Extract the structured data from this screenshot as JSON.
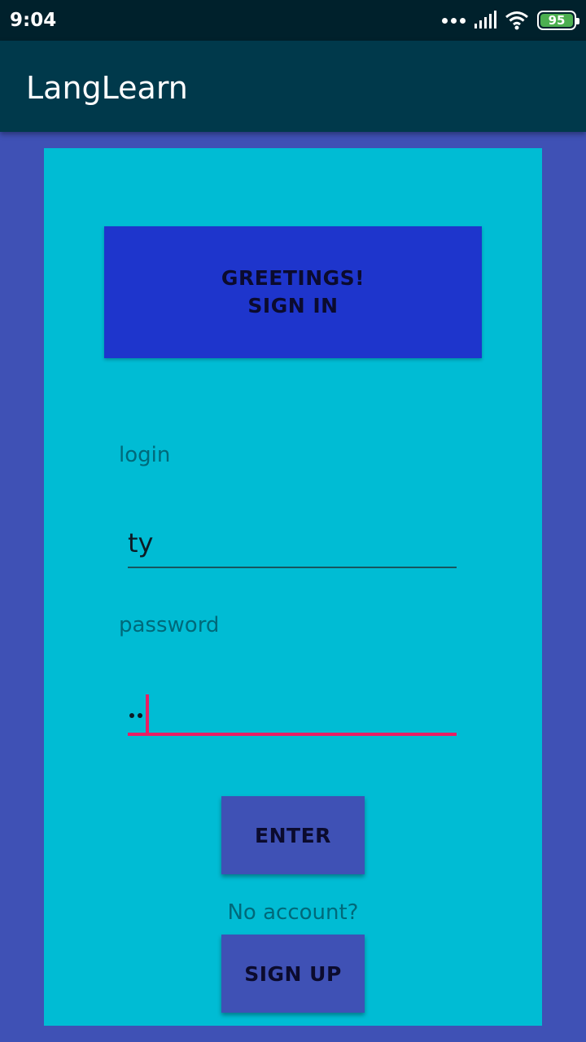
{
  "status_bar": {
    "time": "9:04",
    "battery_level": "95",
    "icons": [
      "more-dots-icon",
      "signal-icon",
      "wifi-icon",
      "battery-icon"
    ]
  },
  "app_bar": {
    "title": "LangLearn"
  },
  "form": {
    "greeting_line1": "GREETINGS!",
    "greeting_line2": "SIGN IN",
    "login_label": "login",
    "login_value": "ty",
    "password_label": "password",
    "password_masked_length": 2,
    "enter_label": "ENTER",
    "no_account_text": "No account?",
    "signup_label": "SIGN UP"
  },
  "colors": {
    "background": "#3f51b5",
    "status_bar": "#00212c",
    "app_bar": "#00394b",
    "panel": "#00bcd4",
    "greeting_box": "#1e35cc",
    "accent": "#e91e63",
    "battery": "#4caf50"
  }
}
